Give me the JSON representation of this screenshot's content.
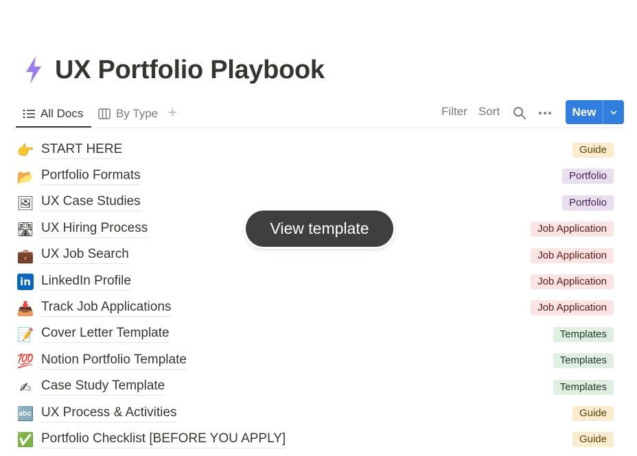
{
  "page": {
    "title": "UX Portfolio Playbook",
    "icon": "lightning-icon",
    "icon_color": "#9d7cf0"
  },
  "views": {
    "tabs": [
      {
        "label": "All Docs",
        "icon": "list-icon",
        "active": true
      },
      {
        "label": "By Type",
        "icon": "board-icon",
        "active": false
      }
    ],
    "add_icon": "plus-icon"
  },
  "actions": {
    "filter": "Filter",
    "sort": "Sort",
    "search_icon": "search-icon",
    "more_icon": "more-icon"
  },
  "new_button": {
    "label": "New",
    "color": "#2f7ee0"
  },
  "overlay": {
    "label": "View template"
  },
  "docs": [
    {
      "emoji": "👉",
      "title": "START HERE",
      "tag": "Guide"
    },
    {
      "emoji": "📂",
      "title": "Portfolio Formats",
      "tag": "Portfolio"
    },
    {
      "emoji": "🖼",
      "title": "UX Case Studies",
      "tag": "Portfolio"
    },
    {
      "emoji": "🛣",
      "title": "UX Hiring Process",
      "tag": "Job Application"
    },
    {
      "emoji": "💼",
      "title": "UX Job Search",
      "tag": "Job Application"
    },
    {
      "emoji": "in",
      "title": "LinkedIn Profile",
      "tag": "Job Application"
    },
    {
      "emoji": "📥",
      "title": "Track Job Applications",
      "tag": "Job Application"
    },
    {
      "emoji": "📝",
      "title": "Cover Letter Template",
      "tag": "Templates"
    },
    {
      "emoji": "💯",
      "title": "Notion Portfolio Template",
      "tag": "Templates"
    },
    {
      "emoji": "✍",
      "title": "Case Study Template",
      "tag": "Templates"
    },
    {
      "emoji": "🔤",
      "title": "UX Process & Activities",
      "tag": "Guide"
    },
    {
      "emoji": "✅",
      "title": "Portfolio Checklist [BEFORE YOU APPLY]",
      "tag": "Guide"
    }
  ]
}
